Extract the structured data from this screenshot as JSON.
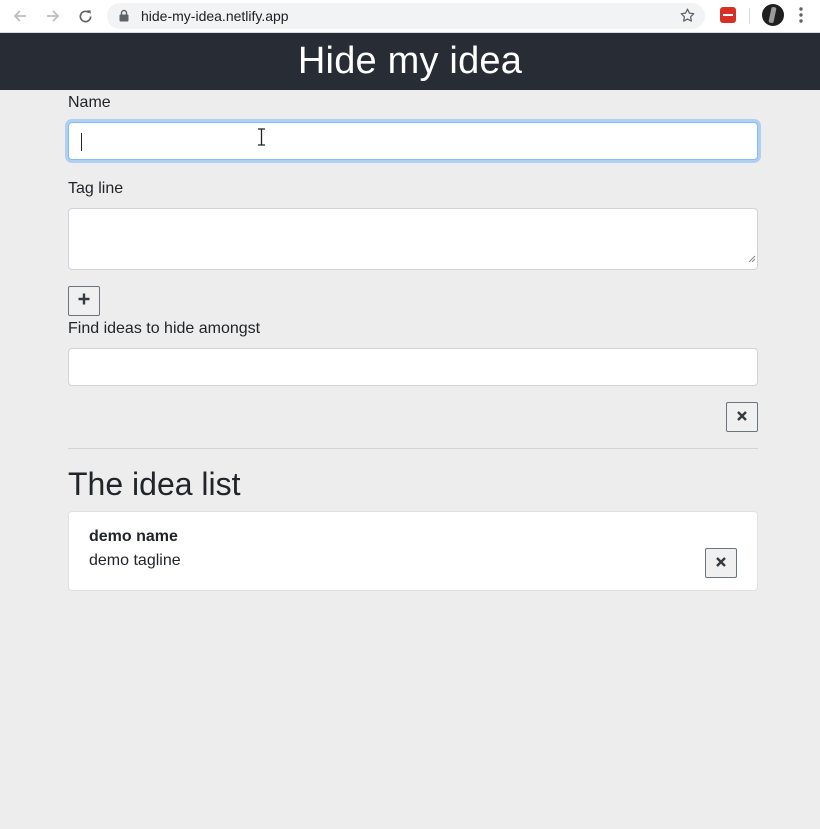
{
  "browser": {
    "url": "hide-my-idea.netlify.app",
    "icons": [
      "back-arrow-icon",
      "forward-arrow-icon",
      "reload-icon",
      "lock-icon",
      "star-icon",
      "extension-icon",
      "profile-avatar",
      "kebab-menu-icon"
    ]
  },
  "header": {
    "title": "Hide my idea"
  },
  "form": {
    "name_label": "Name",
    "name_value": "",
    "tagline_label": "Tag line",
    "tagline_value": "",
    "add_button_icon": "plus-icon",
    "search_label": "Find ideas to hide amongst",
    "search_value": "",
    "clear_button_icon": "close-icon"
  },
  "idea_list": {
    "title": "The idea list",
    "items": [
      {
        "name": "demo name",
        "tagline": "demo tagline",
        "remove_icon": "close-icon"
      }
    ]
  },
  "colors": {
    "header_bg": "#282c34",
    "page_bg": "#ededed",
    "focus_border": "#80bdff"
  }
}
